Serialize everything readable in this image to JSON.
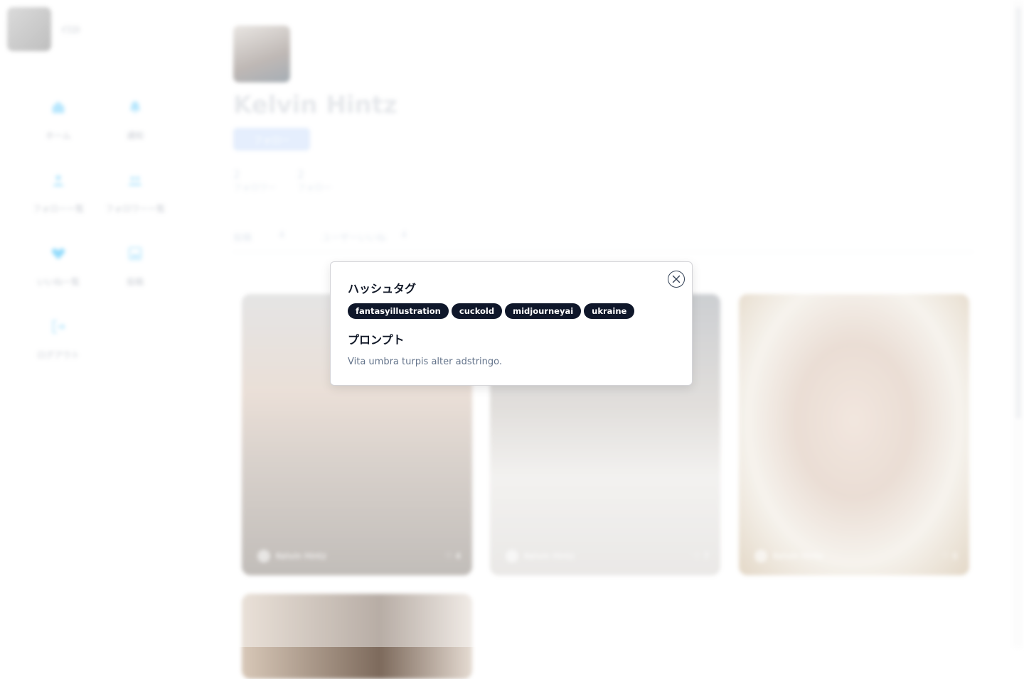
{
  "sidebar": {
    "brand_name": "ｲﾗｽﾄ",
    "items": [
      {
        "label": "ホーム",
        "icon": "home-icon",
        "color": "#7dd3fc"
      },
      {
        "label": "通知",
        "icon": "bell-icon",
        "color": "#7dd3fc"
      },
      {
        "label": "フォロー一覧",
        "icon": "user-icon",
        "color": "#7dd3fc"
      },
      {
        "label": "フォロワー一覧",
        "icon": "users-icon",
        "color": "#7dd3fc"
      },
      {
        "label": "いいね一覧",
        "icon": "heart-icon",
        "color": "#38bdf8"
      },
      {
        "label": "投稿",
        "icon": "image-plus-icon",
        "color": "#7dd3fc"
      },
      {
        "label": "ログアウト",
        "icon": "logout-icon",
        "color": "#7dd3fc"
      }
    ]
  },
  "profile": {
    "name": "Kelvin Hintz",
    "follow_label": "フォロー",
    "followers_count": "2",
    "followers_label": "フォロワー",
    "following_count": "2",
    "following_label": "フォロー"
  },
  "tabs": [
    {
      "label": "投稿",
      "count": "4"
    },
    {
      "label": "ユーザーいいね",
      "count": "4"
    }
  ],
  "cards": [
    {
      "author": "Kelvin Hintz",
      "likes": "♡ 4"
    },
    {
      "author": "Kelvin Hintz",
      "likes": "♡ 7"
    },
    {
      "author": "Kelvin Hintz",
      "likes": "♡ 0"
    },
    {
      "author": "",
      "likes": ""
    }
  ],
  "modal": {
    "hashtags_heading": "ハッシュタグ",
    "tags": [
      "fantasyillustration",
      "cuckold",
      "midjourneyai",
      "ukraine"
    ],
    "prompt_heading": "プロンプト",
    "prompt_text": "Vita umbra turpis alter adstringo."
  },
  "colors": {
    "accent": "#0f172a",
    "follow_button": "#cfe0fb",
    "muted_text": "#64748b"
  }
}
